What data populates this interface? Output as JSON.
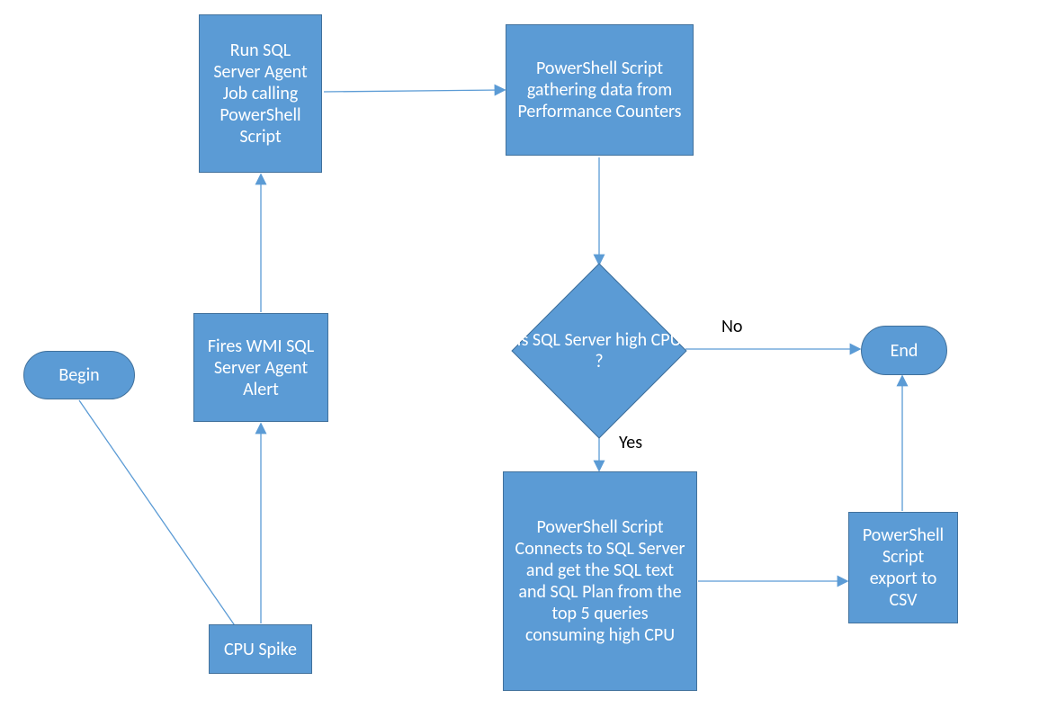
{
  "colors": {
    "fill": "#5b9bd5",
    "stroke": "#41719c",
    "arrow": "#5b9bd5"
  },
  "nodes": {
    "begin": {
      "label": "Begin"
    },
    "cpu_spike": {
      "label": "CPU Spike"
    },
    "fires_wmi": {
      "label": "Fires WMI SQL Server Agent Alert"
    },
    "run_sql": {
      "label": "Run SQL Server Agent Job calling PowerShell Script"
    },
    "gather": {
      "label": "PowerShell Script gathering data from Performance Counters"
    },
    "decision": {
      "label": "Is SQL Server high CPU ?"
    },
    "get_queries": {
      "label": "PowerShell Script Connects to SQL Server and get the SQL text and SQL Plan from the top 5 queries consuming high CPU"
    },
    "export_csv": {
      "label": "PowerShell Script export to CSV"
    },
    "end": {
      "label": "End"
    }
  },
  "edge_labels": {
    "no": "No",
    "yes": "Yes"
  },
  "chart_data": {
    "type": "flowchart",
    "nodes": [
      {
        "id": "begin",
        "kind": "terminator",
        "label": "Begin"
      },
      {
        "id": "cpu_spike",
        "kind": "process",
        "label": "CPU Spike"
      },
      {
        "id": "fires_wmi",
        "kind": "process",
        "label": "Fires WMI SQL Server Agent Alert"
      },
      {
        "id": "run_sql",
        "kind": "process",
        "label": "Run SQL Server Agent Job calling PowerShell Script"
      },
      {
        "id": "gather",
        "kind": "process",
        "label": "PowerShell Script gathering data from Performance Counters"
      },
      {
        "id": "decision",
        "kind": "decision",
        "label": "Is SQL Server high CPU ?"
      },
      {
        "id": "get_queries",
        "kind": "process",
        "label": "PowerShell Script Connects to SQL Server and get the SQL text and SQL Plan from the top 5 queries consuming high CPU"
      },
      {
        "id": "export_csv",
        "kind": "process",
        "label": "PowerShell Script export to CSV"
      },
      {
        "id": "end",
        "kind": "terminator",
        "label": "End"
      }
    ],
    "edges": [
      {
        "from": "begin",
        "to": "cpu_spike",
        "label": null
      },
      {
        "from": "cpu_spike",
        "to": "fires_wmi",
        "label": null
      },
      {
        "from": "fires_wmi",
        "to": "run_sql",
        "label": null
      },
      {
        "from": "run_sql",
        "to": "gather",
        "label": null
      },
      {
        "from": "gather",
        "to": "decision",
        "label": null
      },
      {
        "from": "decision",
        "to": "end",
        "label": "No"
      },
      {
        "from": "decision",
        "to": "get_queries",
        "label": "Yes"
      },
      {
        "from": "get_queries",
        "to": "export_csv",
        "label": null
      },
      {
        "from": "export_csv",
        "to": "end",
        "label": null
      }
    ]
  }
}
